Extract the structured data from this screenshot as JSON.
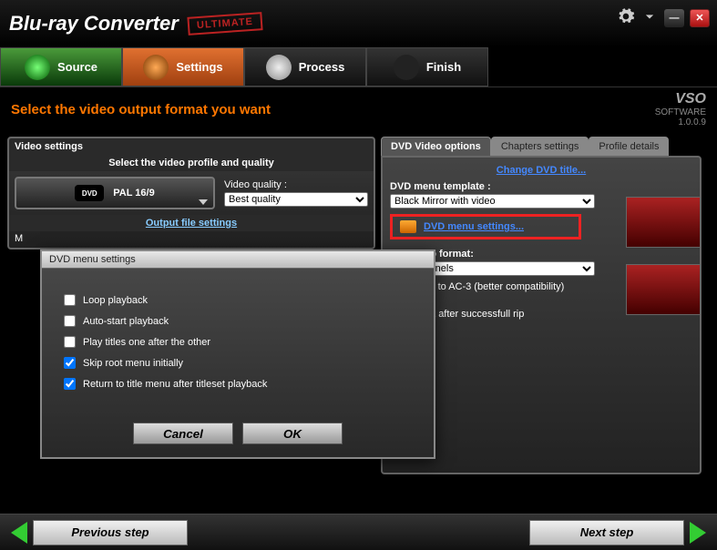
{
  "header": {
    "title": "Blu-ray Converter",
    "badge": "ULTIMATE"
  },
  "tabs": [
    "Source",
    "Settings",
    "Process",
    "Finish"
  ],
  "subtitle": "Select the video output format you want",
  "brand": {
    "name": "VSO",
    "sub": "SOFTWARE",
    "version": "1.0.0.9"
  },
  "left": {
    "videoSettingsTitle": "Video settings",
    "profileSubtitle": "Select the video profile and quality",
    "profileValue": "PAL 16/9",
    "qualityLabel": "Video quality :",
    "qualityValue": "Best quality",
    "outputTitle": "Output file settings",
    "outputRowPrefix": "M"
  },
  "right": {
    "tabs": [
      "DVD Video options",
      "Chapters settings",
      "Profile details"
    ],
    "changeTitle": "Change DVD title...",
    "menuTemplateLabel": "DVD menu template :",
    "menuTemplateValue": "Black Mirror with video",
    "menuSettingsLink": "DVD menu settings...",
    "audioLabel": "t Audio to format:",
    "audioValue": "5.1 Channels",
    "dtsLabel": "nvert DTS to AC-3 (better compatibility)",
    "finalResultLabel": "final result after successfull rip"
  },
  "dialog": {
    "title": "DVD menu settings",
    "options": [
      "Loop playback",
      "Auto-start playback",
      "Play titles one after the other",
      "Skip root menu initially",
      "Return to title menu after titleset playback"
    ],
    "cancel": "Cancel",
    "ok": "OK"
  },
  "footer": {
    "prev": "Previous step",
    "next": "Next step"
  }
}
